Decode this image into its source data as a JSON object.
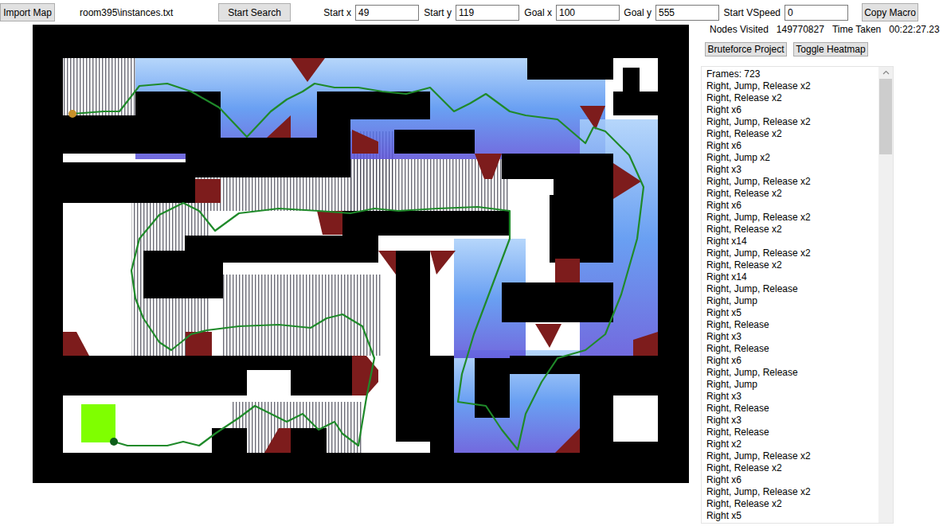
{
  "toolbar": {
    "import_button": "Import Map",
    "file": "room395\\instances.txt",
    "search_button": "Start Search",
    "fields": [
      {
        "label": "Start x",
        "value": "49"
      },
      {
        "label": "Start y",
        "value": "119"
      },
      {
        "label": "Goal x",
        "value": "100"
      },
      {
        "label": "Goal y",
        "value": "555"
      },
      {
        "label": "Start VSpeed",
        "value": "0"
      }
    ],
    "copy_button": "Copy Macro"
  },
  "stats": [
    {
      "label": "Nodes Visited",
      "value": "149770827"
    },
    {
      "label": "Time Taken",
      "value": "00:22:27.23"
    }
  ],
  "buttons": [
    "Bruteforce Project",
    "Toggle Heatmap"
  ],
  "map": {
    "heatmap": true
  },
  "macro": {
    "frames": "Frames: 723",
    "lines": [
      "Right, Jump, Release x2",
      "Right, Release x2",
      "Right x6",
      "Right, Jump, Release x2",
      "Right, Release x2",
      "Right x6",
      "Right, Jump x2",
      "Right x3",
      "Right, Jump, Release x2",
      "Right, Release x2",
      "Right x6",
      "Right, Jump, Release x2",
      "Right, Release x2",
      "Right x14",
      "Right, Jump, Release x2",
      "Right, Release x2",
      "Right x14",
      "Right, Jump, Release",
      "Right, Jump",
      "Right x5",
      "Right, Release",
      "Right x3",
      "Right, Release",
      "Right x6",
      "Right, Jump, Release",
      "Right, Jump",
      "Right x3",
      "Right, Release",
      "Right x3",
      "Right, Release",
      "Right x2",
      "Right, Jump, Release x2",
      "Right, Release x2",
      "Right x6",
      "Right, Jump, Release x2",
      "Right, Release x2",
      "Right x5"
    ]
  }
}
